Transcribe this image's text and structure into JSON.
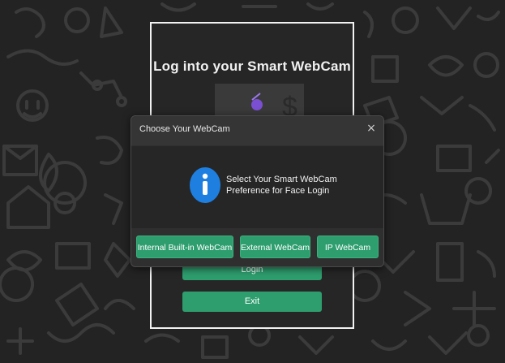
{
  "background": {
    "color": "#232323",
    "doodle_color": "#3b3b3b"
  },
  "login_panel": {
    "title": "Log into your Smart WebCam",
    "login_label": "Login",
    "exit_label": "Exit"
  },
  "dialog": {
    "title": "Choose Your WebCam",
    "close_glyph": "×",
    "message_line1": "Select Your Smart WebCam",
    "message_line2": "Preference for Face Login",
    "icon": "info-icon",
    "buttons": {
      "internal": "Internal Built-in WebCam",
      "external": "External WebCam",
      "ip": "IP WebCam"
    }
  },
  "colors": {
    "accent_green": "#2e9e6e",
    "info_blue": "#1e7fe0"
  }
}
